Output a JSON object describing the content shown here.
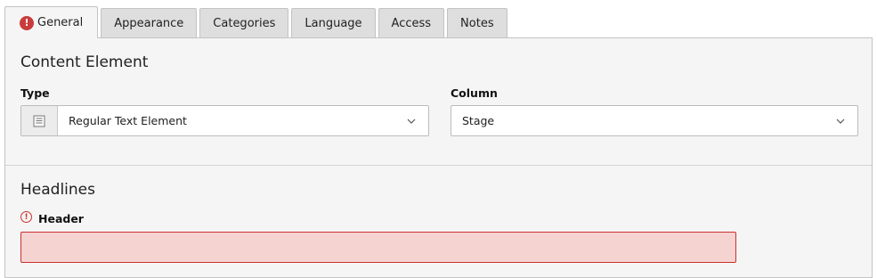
{
  "tabs": [
    {
      "label": "General",
      "active": true,
      "has_error": true
    },
    {
      "label": "Appearance"
    },
    {
      "label": "Categories"
    },
    {
      "label": "Language"
    },
    {
      "label": "Access"
    },
    {
      "label": "Notes"
    }
  ],
  "content_element": {
    "title": "Content Element",
    "type": {
      "label": "Type",
      "value": "Regular Text Element",
      "icon": "text-element-icon"
    },
    "column": {
      "label": "Column",
      "value": "Stage"
    }
  },
  "headlines": {
    "title": "Headlines",
    "header": {
      "label": "Header",
      "value": "",
      "has_error": true
    }
  },
  "colors": {
    "error": "#c8322e",
    "error_fill": "#f5d3d1",
    "panel": "#f5f5f5",
    "tab_inactive": "#dedede"
  }
}
